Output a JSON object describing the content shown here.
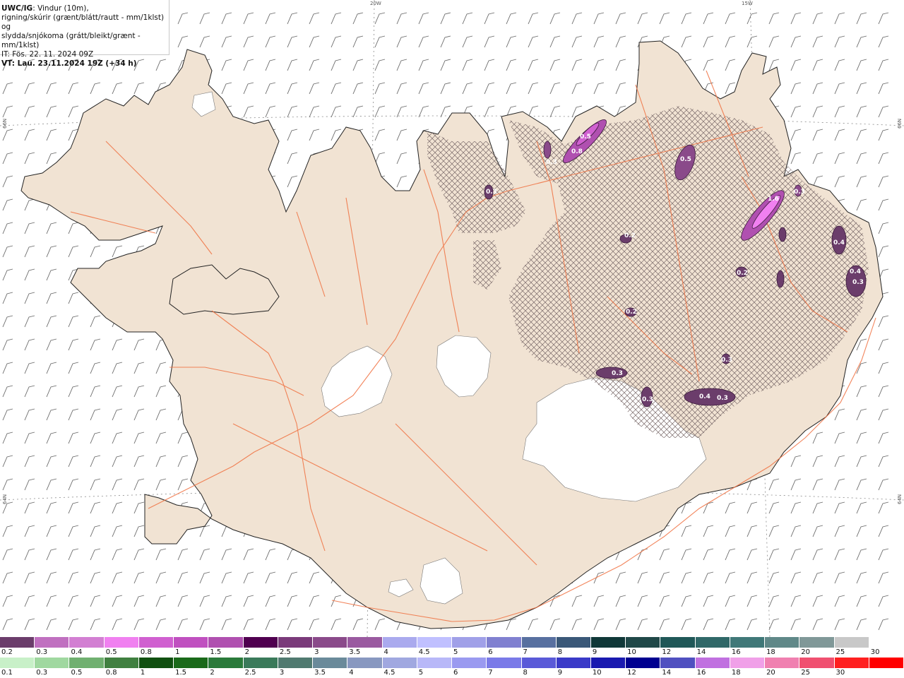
{
  "header": {
    "code": "UWC/IG",
    "line1_rest": ": Vindur (10m),",
    "line2": "rigning/skúrir (grænt/blátt/rautt - mm/1klst) og",
    "line3": "slydda/snjókoma (grátt/bleikt/grænt - mm/1klst)",
    "line4": "IT: Fös. 22. 11. 2024 09Z",
    "line5": "VT: Lau. 23.11.2024 19Z (+34 h)"
  },
  "coords": {
    "top_20w": "20W",
    "top_15w": "15W",
    "left_66n": "66N",
    "left_64n": "64N",
    "right_66n": "66N",
    "right_64n": "64N"
  },
  "colors": {
    "sea": "#ffffff",
    "land": "#f1e3d3",
    "coast": "#222222",
    "roads": "#f07040",
    "glacier": "#ffffff",
    "graticule": "#8a8a8a",
    "barb": "#6a6a6a",
    "hatch": "#7a6a6a"
  },
  "precip_labels": [
    "0.5",
    "0.8",
    "0.3",
    "0.5",
    "1.6",
    "0.3",
    "0.4",
    "0.4",
    "0.3",
    "0.3",
    "0.2",
    "0.2",
    "0.3",
    "0.3",
    "0.4",
    "0.3",
    "0.2",
    "0.3"
  ],
  "snow_scale": {
    "labels": [
      "0.2",
      "0.3",
      "0.4",
      "0.5",
      "0.8",
      "1",
      "1.5",
      "2",
      "2.5",
      "3",
      "3.5",
      "4",
      "4.5",
      "5",
      "6",
      "7",
      "8",
      "9",
      "10",
      "12",
      "14",
      "16",
      "18",
      "20",
      "25",
      "30"
    ],
    "colors": [
      "#6b3d6b",
      "#c070c0",
      "#d27fd2",
      "#f080f0",
      "#d060d0",
      "#c050c0",
      "#b050b0",
      "#500050",
      "#7a3a7a",
      "#8a4a8a",
      "#9a5aa0",
      "#aaaaee",
      "#c0c0ff",
      "#a0a0e8",
      "#8080d0",
      "#5870a0",
      "#3a5878",
      "#103838",
      "#204848",
      "#205858",
      "#306868",
      "#407878",
      "#608888",
      "#809898",
      "#c8c8c8",
      "#ffffff"
    ]
  },
  "rain_scale": {
    "labels": [
      "0.1",
      "0.3",
      "0.5",
      "0.8",
      "1",
      "1.5",
      "2",
      "2.5",
      "3",
      "3.5",
      "4",
      "4.5",
      "5",
      "6",
      "7",
      "8",
      "9",
      "10",
      "12",
      "14",
      "16",
      "18",
      "20",
      "25",
      "30"
    ],
    "colors": [
      "#c8f0c8",
      "#a0d8a0",
      "#70b070",
      "#408040",
      "#105010",
      "#1a6a1a",
      "#2a7a3a",
      "#3a7a5a",
      "#507a70",
      "#6a8a9a",
      "#8898c0",
      "#a0a8e0",
      "#b8b8f8",
      "#9a9af0",
      "#7a7ae8",
      "#5a5ad8",
      "#3a3ac8",
      "#1a1ab0",
      "#000090",
      "#5050c0",
      "#c070e0",
      "#f0a0e8",
      "#f080b0",
      "#f05070",
      "#ff2020",
      "#ff0000"
    ]
  }
}
